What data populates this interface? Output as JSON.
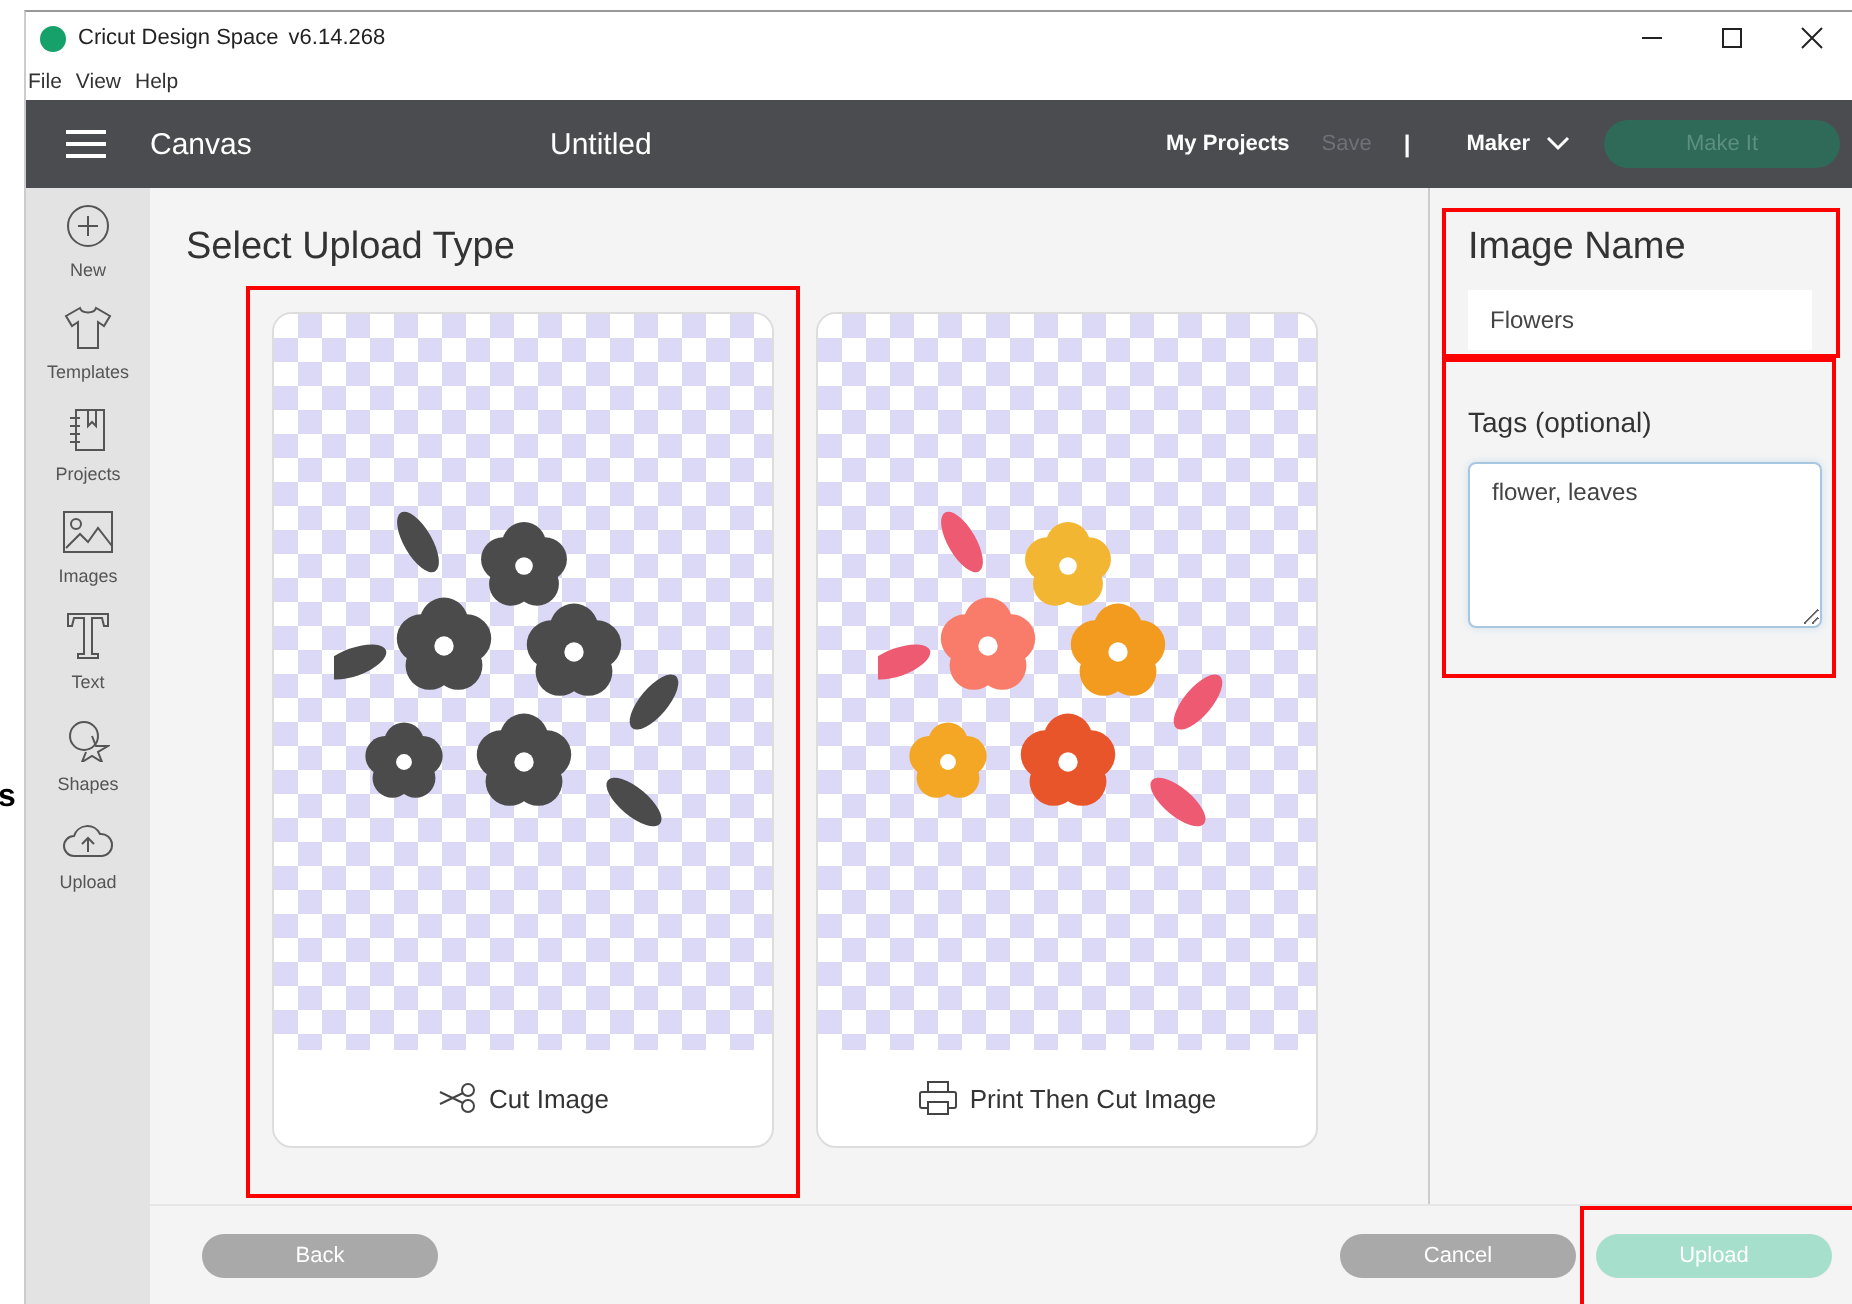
{
  "edge_fragment": "s",
  "window": {
    "title": "Cricut Design Space",
    "version": "v6.14.268"
  },
  "menu": [
    "File",
    "View",
    "Help"
  ],
  "header": {
    "section": "Canvas",
    "project_title": "Untitled",
    "links": [
      {
        "label": "My Projects",
        "disabled": false
      },
      {
        "label": "Save",
        "disabled": true
      }
    ],
    "separator": "|",
    "machine": "Maker",
    "action": {
      "label": "Make It",
      "disabled": true
    }
  },
  "sidebar": {
    "items": [
      {
        "label": "New"
      },
      {
        "label": "Templates"
      },
      {
        "label": "Projects"
      },
      {
        "label": "Images"
      },
      {
        "label": "Text"
      },
      {
        "label": "Shapes"
      },
      {
        "label": "Upload"
      }
    ]
  },
  "main": {
    "heading": "Select Upload Type",
    "options": [
      {
        "label": "Cut Image",
        "kind": "cut",
        "highlighted": true
      },
      {
        "label": "Print Then Cut Image",
        "kind": "print",
        "highlighted": false
      }
    ]
  },
  "details": {
    "name_label": "Image Name",
    "name_value": "Flowers",
    "name_highlighted": true,
    "tags_label": "Tags (optional)",
    "tags_value": "flower, leaves",
    "tags_highlighted": true
  },
  "footer": {
    "buttons": [
      {
        "label": "Back",
        "kind": "secondary",
        "disabled": false,
        "highlighted": false
      },
      {
        "label": "Cancel",
        "kind": "secondary",
        "disabled": false,
        "highlighted": false
      },
      {
        "label": "Upload",
        "kind": "primary",
        "disabled": true,
        "highlighted": true
      }
    ]
  }
}
